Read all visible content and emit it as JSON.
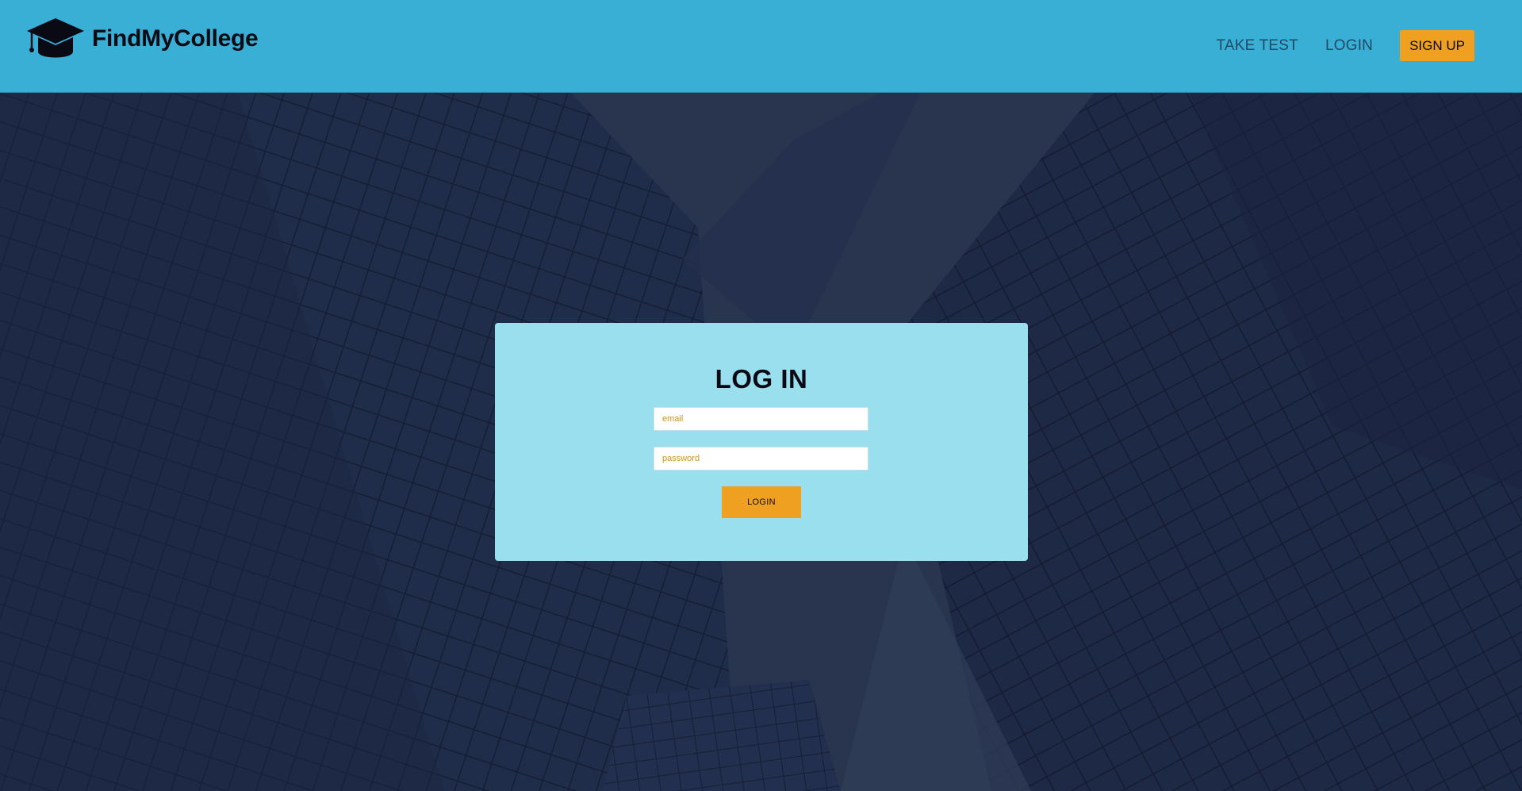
{
  "brand": {
    "name": "FindMyCollege",
    "icon": "graduation-cap-icon"
  },
  "nav": {
    "take_test": "TAKE TEST",
    "login": "LOGIN",
    "signup": "SIGN UP"
  },
  "login_form": {
    "title": "LOG IN",
    "email_placeholder": "email",
    "password_placeholder": "password",
    "submit_label": "LOGIN"
  },
  "colors": {
    "header_bg": "#3aafd6",
    "accent": "#f0a020",
    "card_bg": "#9adfee",
    "hero_overlay": "#24304c"
  }
}
